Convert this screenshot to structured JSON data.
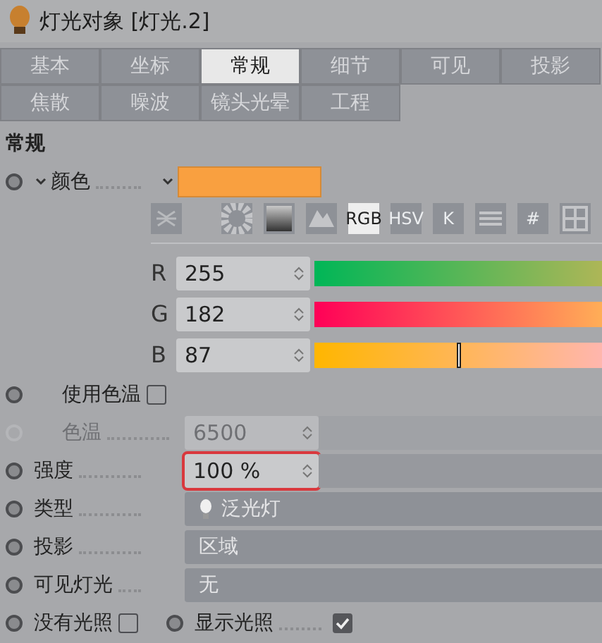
{
  "window": {
    "title": "灯光对象 [灯光.2]"
  },
  "tab_rows": [
    {
      "tabs": [
        {
          "label": "基本",
          "selected": false
        },
        {
          "label": "坐标",
          "selected": false
        },
        {
          "label": "常规",
          "selected": true
        },
        {
          "label": "细节",
          "selected": false
        },
        {
          "label": "可见",
          "selected": false
        },
        {
          "label": "投影",
          "selected": false
        }
      ]
    },
    {
      "tabs": [
        {
          "label": "焦散",
          "selected": false
        },
        {
          "label": "噪波",
          "selected": false
        },
        {
          "label": "镜头光晕",
          "selected": false
        },
        {
          "label": "工程",
          "selected": false
        }
      ]
    }
  ],
  "section_title": "常规",
  "color": {
    "label": "颜色",
    "expanded": true,
    "color": "#f9a040"
  },
  "color_modes": [
    {
      "kind": "collapse",
      "selected": false
    },
    {
      "kind": "wheel",
      "selected": false
    },
    {
      "kind": "spectrum",
      "selected": false
    },
    {
      "kind": "picture",
      "selected": false
    },
    {
      "kind": "text",
      "label": "RGB",
      "selected": true
    },
    {
      "kind": "text",
      "label": "HSV",
      "selected": false
    },
    {
      "kind": "text",
      "label": "K",
      "selected": false
    },
    {
      "kind": "mixer",
      "selected": false
    },
    {
      "kind": "text",
      "label": "#",
      "selected": false
    },
    {
      "kind": "grid",
      "selected": false
    }
  ],
  "channels": [
    {
      "name": "R",
      "value": "255",
      "level": 1
    },
    {
      "name": "G",
      "value": "182",
      "level": 0.714
    },
    {
      "name": "B",
      "value": "87",
      "level": 0.341
    }
  ],
  "properties": [
    {
      "kind": "checkbox",
      "label": "使用色温",
      "checked": false
    },
    {
      "kind": "number",
      "label": "色温",
      "value": "6500",
      "disabled": true,
      "highlighted": false
    },
    {
      "kind": "number",
      "label": "强度",
      "value": "100 %",
      "disabled": false,
      "highlighted": true
    },
    {
      "kind": "dropdown",
      "label": "类型",
      "value": "泛光灯",
      "icon": true
    },
    {
      "kind": "dropdown",
      "label": "投影",
      "value": "区域"
    },
    {
      "kind": "dropdown",
      "label": "可见灯光",
      "value": "无"
    },
    {
      "kind": "pair",
      "items": [
        {
          "label": "没有光照",
          "checked": false
        },
        {
          "label": "显示光照",
          "checked": true
        }
      ]
    }
  ]
}
